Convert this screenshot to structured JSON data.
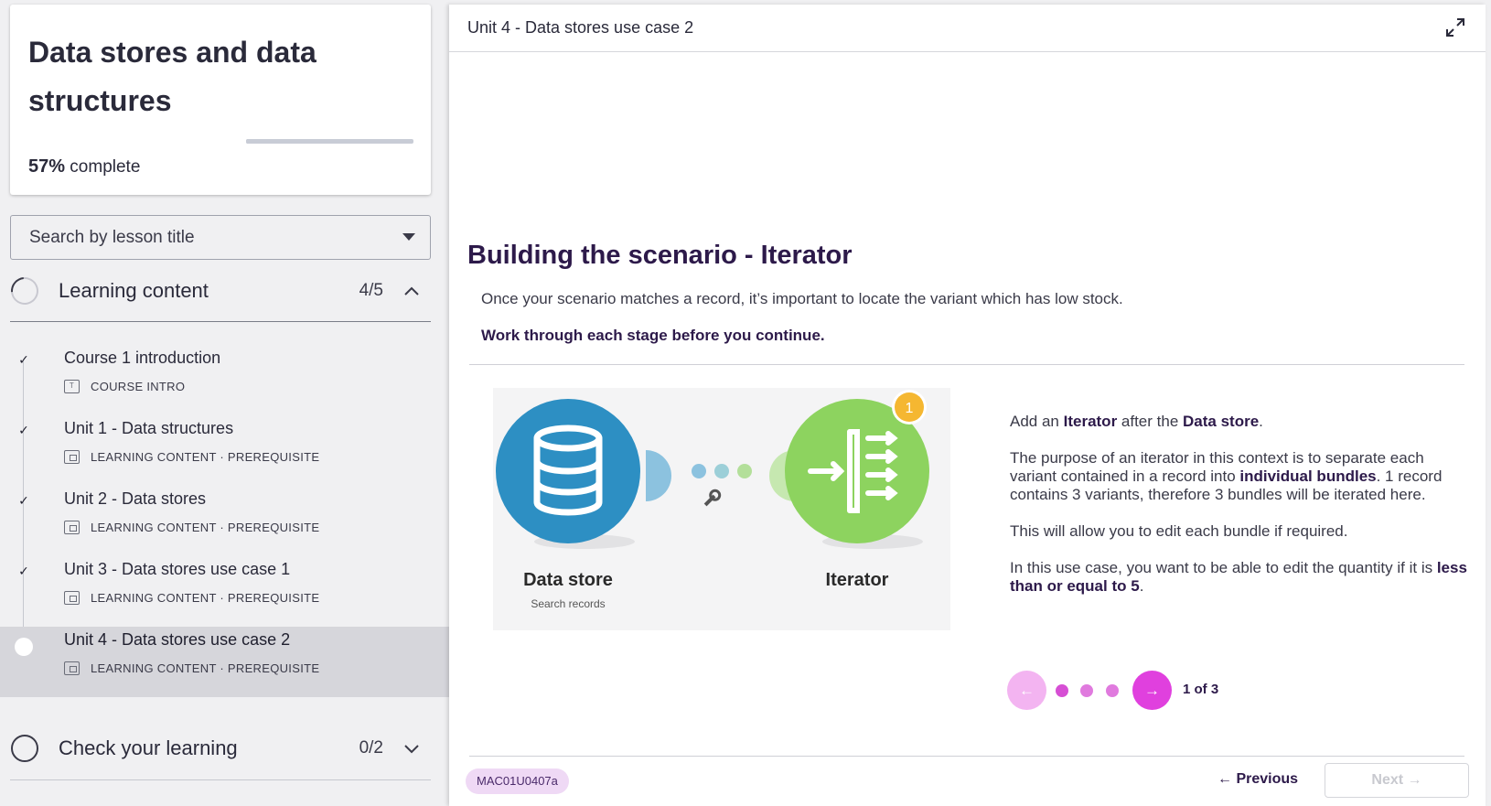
{
  "course": {
    "title": "Data stores and data structures",
    "progress_pct": 57,
    "progress_value": "57%",
    "progress_suffix": " complete"
  },
  "search": {
    "placeholder": "Search by lesson title"
  },
  "sections": {
    "learning": {
      "label": "Learning content",
      "count": "4/5",
      "expanded": true
    },
    "check": {
      "label": "Check your learning",
      "count": "0/2",
      "expanded": false
    }
  },
  "lessons": [
    {
      "title": "Course 1 introduction",
      "meta": "COURSE INTRO",
      "icon": "document-icon",
      "done": true
    },
    {
      "title": "Unit 1 - Data structures",
      "meta": "LEARNING CONTENT · PREREQUISITE",
      "icon": "slides-icon",
      "done": true
    },
    {
      "title": "Unit 2 - Data stores",
      "meta": "LEARNING CONTENT · PREREQUISITE",
      "icon": "slides-icon",
      "done": true
    },
    {
      "title": "Unit 3 - Data stores use case 1",
      "meta": "LEARNING CONTENT · PREREQUISITE",
      "icon": "slides-icon",
      "done": true
    },
    {
      "title": "Unit 4 - Data stores use case 2",
      "meta": "LEARNING CONTENT · PREREQUISITE",
      "icon": "slides-icon",
      "done": false,
      "active": true
    }
  ],
  "main": {
    "title": "Unit 4 - Data stores use case 2",
    "heading": "Building the scenario - Iterator",
    "intro": "Once your scenario matches a record, it’s important to locate the variant which has low stock.",
    "instruction": "Work through each stage before you continue.",
    "diagram": {
      "left_module": "Data store",
      "left_sub": "Search records",
      "right_module": "Iterator",
      "badge": "1"
    },
    "panel": {
      "p1_a": "Add an ",
      "p1_b": "Iterator",
      "p1_c": " after the ",
      "p1_d": "Data store",
      "p1_e": ".",
      "p2_a": "The purpose of an iterator in this context is to separate each variant contained in a record into ",
      "p2_b": "individual bundles",
      "p2_c": ". 1 record contains 3 variants, therefore 3 bundles will be iterated here.",
      "p3": "This will allow you to edit each bundle if required.",
      "p4_a": "In this use case, you want to be able to edit the quantity if it is ",
      "p4_b": "less than or equal to 5",
      "p4_c": "."
    },
    "carousel": {
      "current": 1,
      "total": 3,
      "counter": "1 of 3"
    },
    "code": "MAC01U0407a",
    "prev_label": "Previous",
    "next_label": "Next"
  },
  "colors": {
    "accent": "#e040de",
    "accent_light": "#f3b4f1",
    "heading": "#2d1a4a",
    "datastore_blue": "#2d8fc3",
    "iterator_green": "#8dd35f",
    "badge_orange": "#f5b731"
  }
}
